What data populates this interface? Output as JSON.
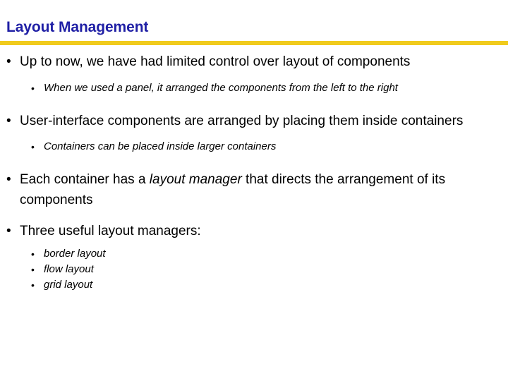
{
  "slide": {
    "title": "Layout Management",
    "accent_color": "#f0cb1d",
    "title_color": "#1f1fa5",
    "body_color": "#000000",
    "background_color": "#ffffff",
    "bullet_glyph": "•",
    "content": [
      {
        "level": 1,
        "text": "Up to now, we have had limited control over layout of components"
      },
      {
        "level": 2,
        "text": "When we used a panel, it arranged the components from the left to the right"
      },
      {
        "level": 1,
        "text": "User-interface components are arranged by placing them inside containers"
      },
      {
        "level": 2,
        "text": "Containers can be placed inside larger containers"
      },
      {
        "level": 1,
        "text_before_italic": "Each container has a ",
        "text_italic": "layout manager",
        "text_after_italic": " that directs the arrangement of its components"
      },
      {
        "level": 1,
        "text": "Three useful layout managers:"
      },
      {
        "level": 2,
        "text": "border layout"
      },
      {
        "level": 2,
        "text": "flow layout"
      },
      {
        "level": 2,
        "text": "grid layout"
      }
    ]
  }
}
